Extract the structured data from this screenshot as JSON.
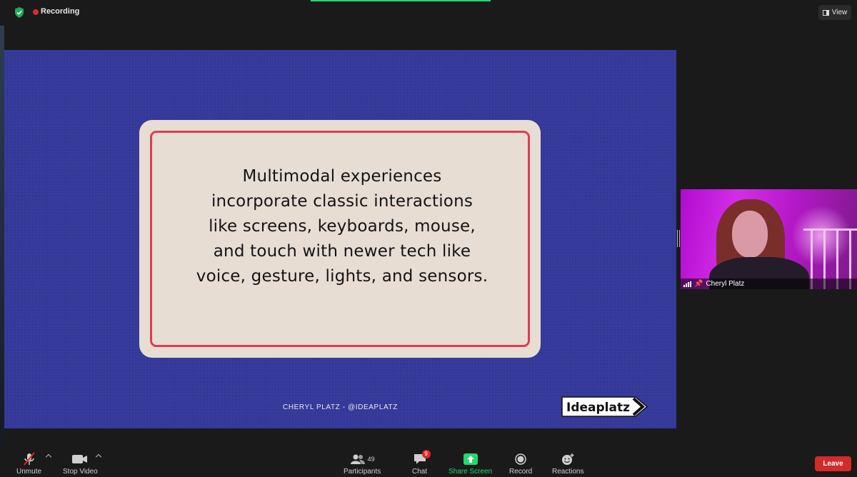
{
  "topbar": {
    "recording_label": "Recording",
    "view_label": "View"
  },
  "slide": {
    "lines": [
      "Multimodal experiences",
      "incorporate classic interactions",
      "like screens, keyboards, mouse,",
      "and touch with newer tech like",
      "voice, gesture, lights, and sensors."
    ],
    "credit": "CHERYL PLATZ - @IDEAPLATZ",
    "brand": "Ideaplatz"
  },
  "participant": {
    "name": "Cheryl Platz"
  },
  "toolbar": {
    "unmute": "Unmute",
    "stop_video": "Stop Video",
    "participants": "Participants",
    "participants_count": "49",
    "chat": "Chat",
    "chat_badge": "9",
    "share_screen": "Share Screen",
    "record": "Record",
    "reactions": "Reactions",
    "leave": "Leave"
  },
  "colors": {
    "slide_bg": "#34399a",
    "card_border": "#dc3d55",
    "share_green": "#23d96c",
    "leave_red": "#d32a2a"
  }
}
